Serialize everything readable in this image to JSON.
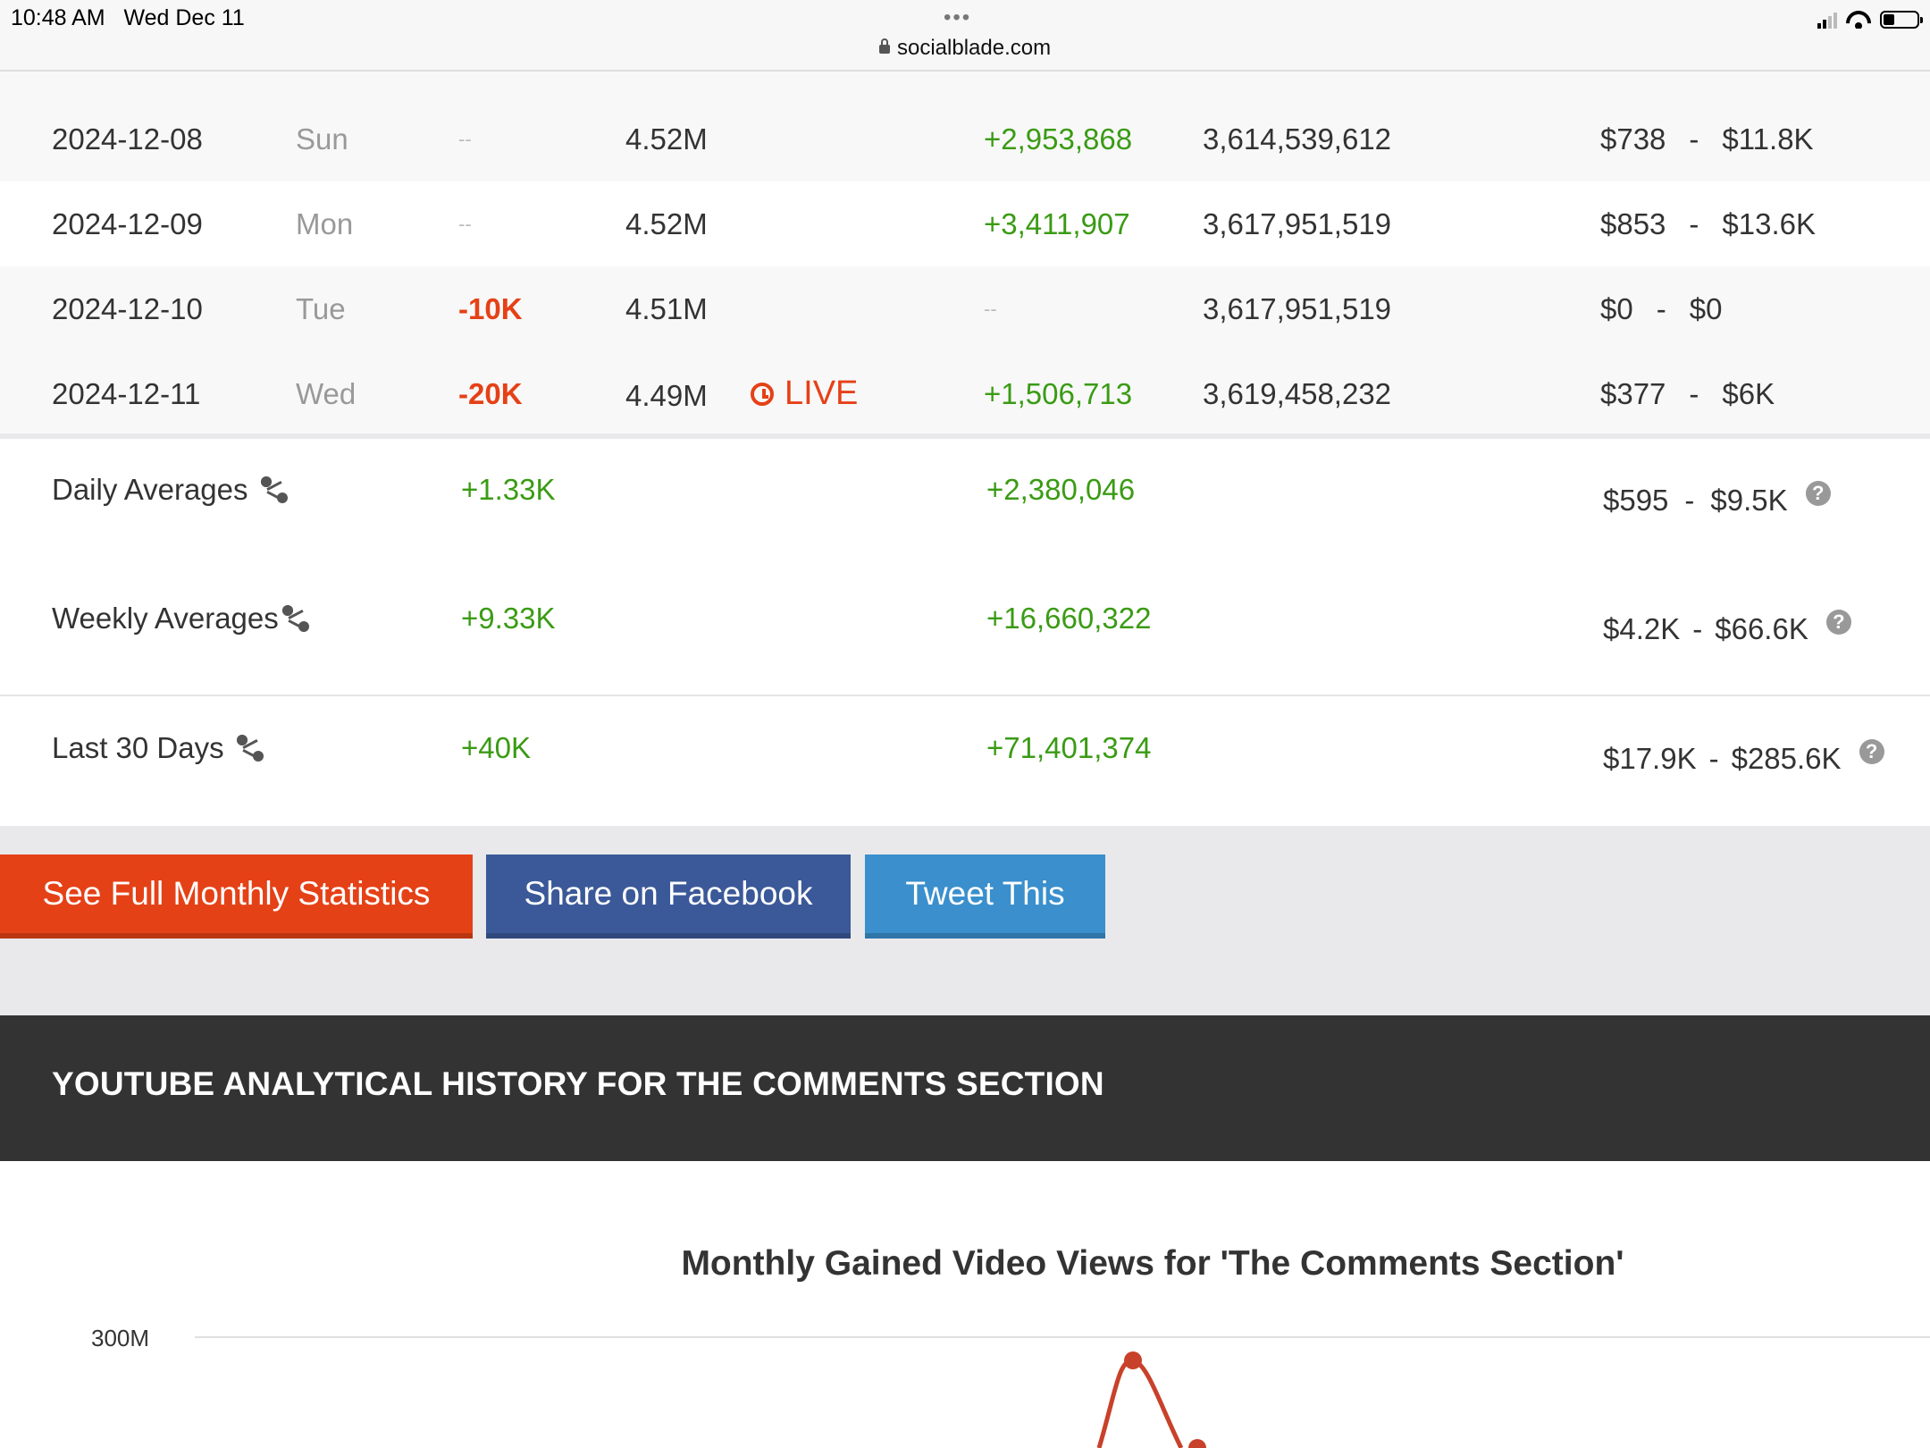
{
  "status_bar": {
    "time": "10:48 AM",
    "date": "Wed Dec 11",
    "url": "socialblade.com",
    "dots": "•••"
  },
  "rows": [
    {
      "date": "2024-12-08",
      "day": "Sun",
      "subs_change": "--",
      "subs_total": "4.52M",
      "live": "",
      "views_change": "+2,953,868",
      "views_total": "3,614,539,612",
      "earn_low": "$738",
      "earn_high": "$11.8K"
    },
    {
      "date": "2024-12-09",
      "day": "Mon",
      "subs_change": "--",
      "subs_total": "4.52M",
      "live": "",
      "views_change": "+3,411,907",
      "views_total": "3,617,951,519",
      "earn_low": "$853",
      "earn_high": "$13.6K"
    },
    {
      "date": "2024-12-10",
      "day": "Tue",
      "subs_change": "-10K",
      "subs_total": "4.51M",
      "live": "",
      "views_change": "--",
      "views_total": "3,617,951,519",
      "earn_low": "$0",
      "earn_high": "$0"
    },
    {
      "date": "2024-12-11",
      "day": "Wed",
      "subs_change": "-20K",
      "subs_total": "4.49M",
      "live": "LIVE",
      "views_change": "+1,506,713",
      "views_total": "3,619,458,232",
      "earn_low": "$377",
      "earn_high": "$6K"
    }
  ],
  "dash": "-",
  "averages": [
    {
      "label": "Daily Averages",
      "subs": "+1.33K",
      "views": "+2,380,046",
      "earn_low": "$595",
      "earn_high": "$9.5K"
    },
    {
      "label": "Weekly Averages",
      "subs": "+9.33K",
      "views": "+16,660,322",
      "earn_low": "$4.2K",
      "earn_high": "$66.6K"
    },
    {
      "label": "Last 30 Days",
      "subs": "+40K",
      "views": "+71,401,374",
      "earn_low": "$17.9K",
      "earn_high": "$285.6K"
    }
  ],
  "help_glyph": "?",
  "buttons": {
    "monthly": "See Full Monthly Statistics",
    "facebook": "Share on Facebook",
    "tweet": "Tweet This"
  },
  "section_title": "YOUTUBE ANALYTICAL HISTORY FOR THE COMMENTS SECTION",
  "chart_data": {
    "type": "line",
    "title": "Monthly Gained Video Views for 'The Comments Section'",
    "y_ticks": [
      "300M"
    ],
    "series_color": "#c8412a"
  },
  "colors": {
    "accent_orange": "#e54117",
    "facebook_blue": "#3b5998",
    "twitter_blue": "#3a8fcc",
    "positive_green": "#3a9b14",
    "dark_header": "#333333"
  },
  "icons": [
    "lock-icon",
    "signal-icon",
    "wifi-icon",
    "battery-icon",
    "share-icon",
    "help-icon",
    "clock-icon"
  ]
}
